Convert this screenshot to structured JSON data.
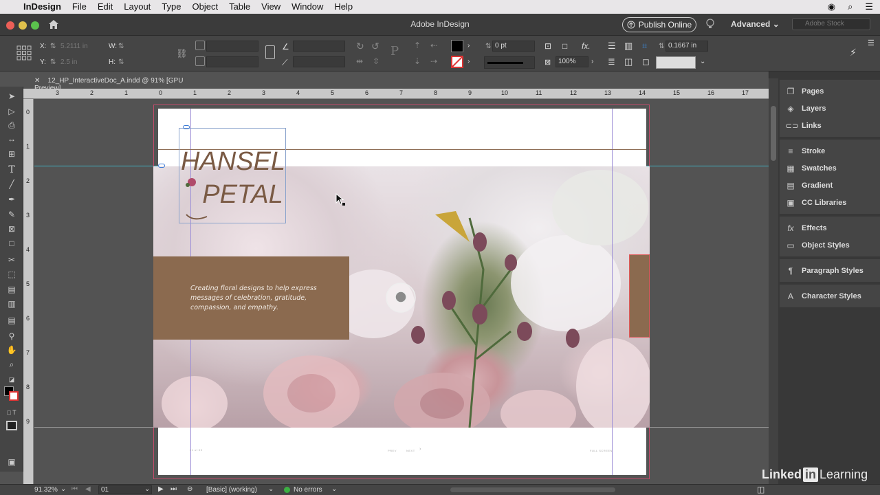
{
  "menubar": {
    "app": "InDesign",
    "items": [
      "File",
      "Edit",
      "Layout",
      "Type",
      "Object",
      "Table",
      "View",
      "Window",
      "Help"
    ]
  },
  "titlebar": {
    "title": "Adobe InDesign",
    "publish_label": "Publish Online",
    "workspace": "Advanced",
    "stock_placeholder": "Adobe Stock"
  },
  "control": {
    "x_label": "X:",
    "x_value": "5.2111 in",
    "y_label": "Y:",
    "y_value": "2.5 in",
    "w_label": "W:",
    "h_label": "H:",
    "stroke_weight": "0 pt",
    "opacity": "100%",
    "offset": "0.1667 in"
  },
  "document": {
    "tab_label": "12_HP_InteractiveDoc_A.indd @ 91% [GPU Preview]",
    "tagline": "Creating floral designs to help express messages of celebration, gratitude, compassion, and empathy.",
    "logo_line1": "HANSEL",
    "logo_line2": "PETAL",
    "footer_left": "01 of 09",
    "footer_prev": "PREV",
    "footer_next": "NEXT",
    "footer_right": "FULL SCREEN"
  },
  "rulers": {
    "horizontal": [
      "3",
      "2",
      "1",
      "0",
      "1",
      "2",
      "3",
      "4",
      "5",
      "6",
      "7",
      "8",
      "9",
      "10",
      "11",
      "12",
      "13",
      "14",
      "15",
      "16",
      "17"
    ],
    "vertical": [
      "0",
      "1",
      "2",
      "3",
      "4",
      "5",
      "6",
      "7",
      "8",
      "9"
    ]
  },
  "panels": [
    {
      "items": [
        {
          "label": "Pages",
          "icon": "pages-icon",
          "glyph": "❐"
        },
        {
          "label": "Layers",
          "icon": "layers-icon",
          "glyph": "◈"
        },
        {
          "label": "Links",
          "icon": "links-icon",
          "glyph": "⊂⊃"
        }
      ]
    },
    {
      "items": [
        {
          "label": "Stroke",
          "icon": "stroke-icon",
          "glyph": "≡"
        },
        {
          "label": "Swatches",
          "icon": "swatches-icon",
          "glyph": "▦"
        },
        {
          "label": "Gradient",
          "icon": "gradient-icon",
          "glyph": "▤"
        },
        {
          "label": "CC Libraries",
          "icon": "cc-libraries-icon",
          "glyph": "▣"
        }
      ]
    },
    {
      "items": [
        {
          "label": "Effects",
          "icon": "effects-icon",
          "glyph": "fx"
        },
        {
          "label": "Object Styles",
          "icon": "object-styles-icon",
          "glyph": "▭"
        }
      ]
    },
    {
      "items": [
        {
          "label": "Paragraph Styles",
          "icon": "paragraph-styles-icon",
          "glyph": "¶"
        }
      ]
    },
    {
      "items": [
        {
          "label": "Character Styles",
          "icon": "character-styles-icon",
          "glyph": "A"
        }
      ]
    }
  ],
  "status": {
    "zoom": "91.32%",
    "page": "01",
    "profile": "[Basic] (working)",
    "errors": "No errors"
  },
  "watermark": {
    "part1": "Linked",
    "part2": "in",
    "part3": "Learning"
  },
  "colors": {
    "brown": "#8b6a4f",
    "logo_brown": "#7a5a44",
    "no_errors": "#3cb043"
  }
}
